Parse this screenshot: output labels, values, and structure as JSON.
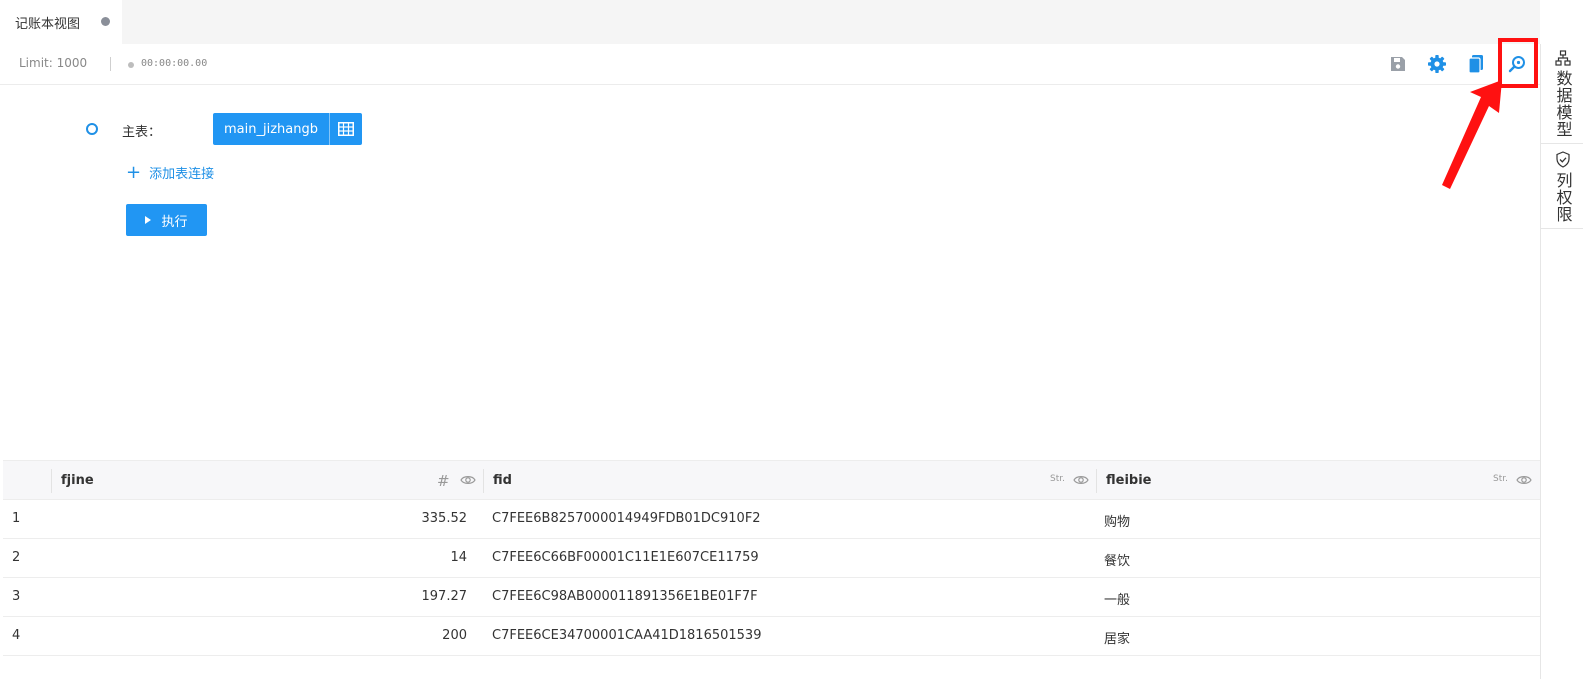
{
  "tab": {
    "title": "记账本视图"
  },
  "toolbar": {
    "limit": "Limit: 1000",
    "timer": "00:00:00.00",
    "icons": [
      "save-icon",
      "settings-gear-icon",
      "copy-icon",
      "sql-search-icon"
    ],
    "accent": "#1f90e6"
  },
  "query": {
    "main_label": "主表：",
    "main_table": "main_jizhangb",
    "add_join": "添加表连接",
    "execute": "执行"
  },
  "side": {
    "data_model": "数据模型",
    "column_permission": "列权限"
  },
  "table": {
    "columns": [
      {
        "name": "fjine",
        "type": "#"
      },
      {
        "name": "fid",
        "type": "Str."
      },
      {
        "name": "fleibie",
        "type": "Str."
      }
    ],
    "rows": [
      {
        "idx": "1",
        "fjine": "335.52",
        "fid": "C7FEE6B8257000014949FDB01DC910F2",
        "fleibie": "购物"
      },
      {
        "idx": "2",
        "fjine": "14",
        "fid": "C7FEE6C66BF00001C11E1E607CE11759",
        "fleibie": "餐饮"
      },
      {
        "idx": "3",
        "fjine": "197.27",
        "fid": "C7FEE6C98AB000011891356E1BE01F7F",
        "fleibie": "一般"
      },
      {
        "idx": "4",
        "fjine": "200",
        "fid": "C7FEE6CE34700001CAA41D1816501539",
        "fleibie": "居家"
      }
    ]
  },
  "colors": {
    "primary": "#2196f3",
    "highlight": "#ff1111"
  }
}
